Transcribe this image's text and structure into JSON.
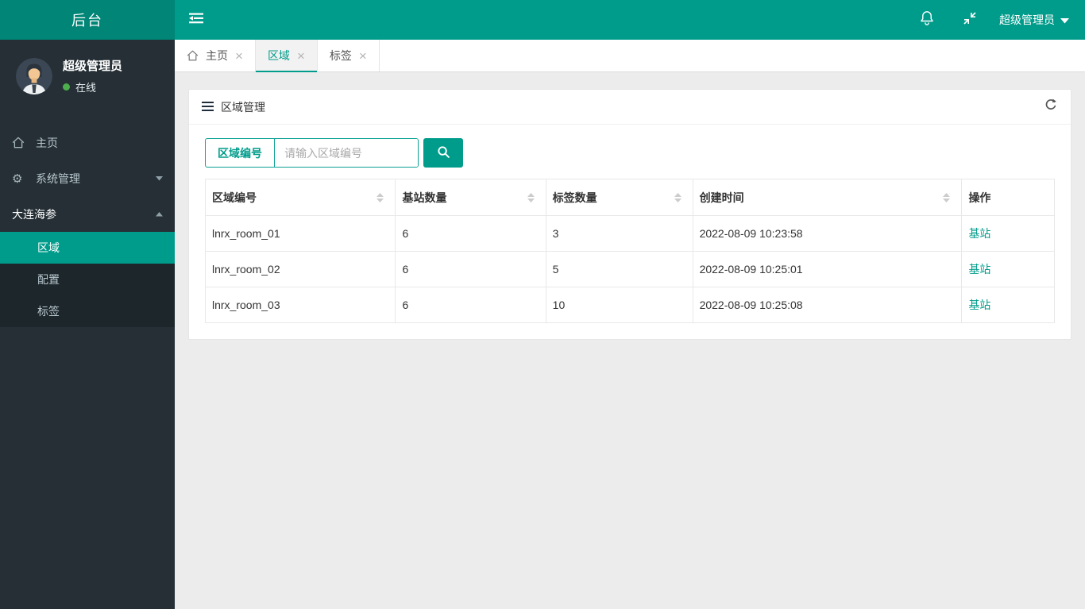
{
  "colors": {
    "accent": "#009c8b",
    "logo_bg": "#008576",
    "sidebar_bg": "#252f35",
    "submenu_bg": "#1d262b",
    "body_bg": "#ececec",
    "status_green": "#4cae4c"
  },
  "header": {
    "logo": "后台",
    "user_menu_label": "超级管理员"
  },
  "sidebar": {
    "user_name": "超级管理员",
    "user_status": "在线",
    "menu": [
      {
        "label": "主页"
      },
      {
        "label": "系统管理"
      },
      {
        "label": "大连海参"
      }
    ],
    "submenu": [
      {
        "label": "区域"
      },
      {
        "label": "配置"
      },
      {
        "label": "标签"
      }
    ]
  },
  "tabs": [
    {
      "label": "主页"
    },
    {
      "label": "区域"
    },
    {
      "label": "标签"
    }
  ],
  "panel": {
    "title": "区域管理",
    "search_addon": "区域编号",
    "search_placeholder": "请输入区域编号"
  },
  "table": {
    "headers": [
      "区域编号",
      "基站数量",
      "标签数量",
      "创建时间",
      "操作"
    ],
    "rows": [
      {
        "area_id": "lnrx_room_01",
        "base_stations": "6",
        "tags": "3",
        "created_at": "2022-08-09 10:23:58",
        "action": "基站"
      },
      {
        "area_id": "lnrx_room_02",
        "base_stations": "6",
        "tags": "5",
        "created_at": "2022-08-09 10:25:01",
        "action": "基站"
      },
      {
        "area_id": "lnrx_room_03",
        "base_stations": "6",
        "tags": "10",
        "created_at": "2022-08-09 10:25:08",
        "action": "基站"
      }
    ]
  }
}
